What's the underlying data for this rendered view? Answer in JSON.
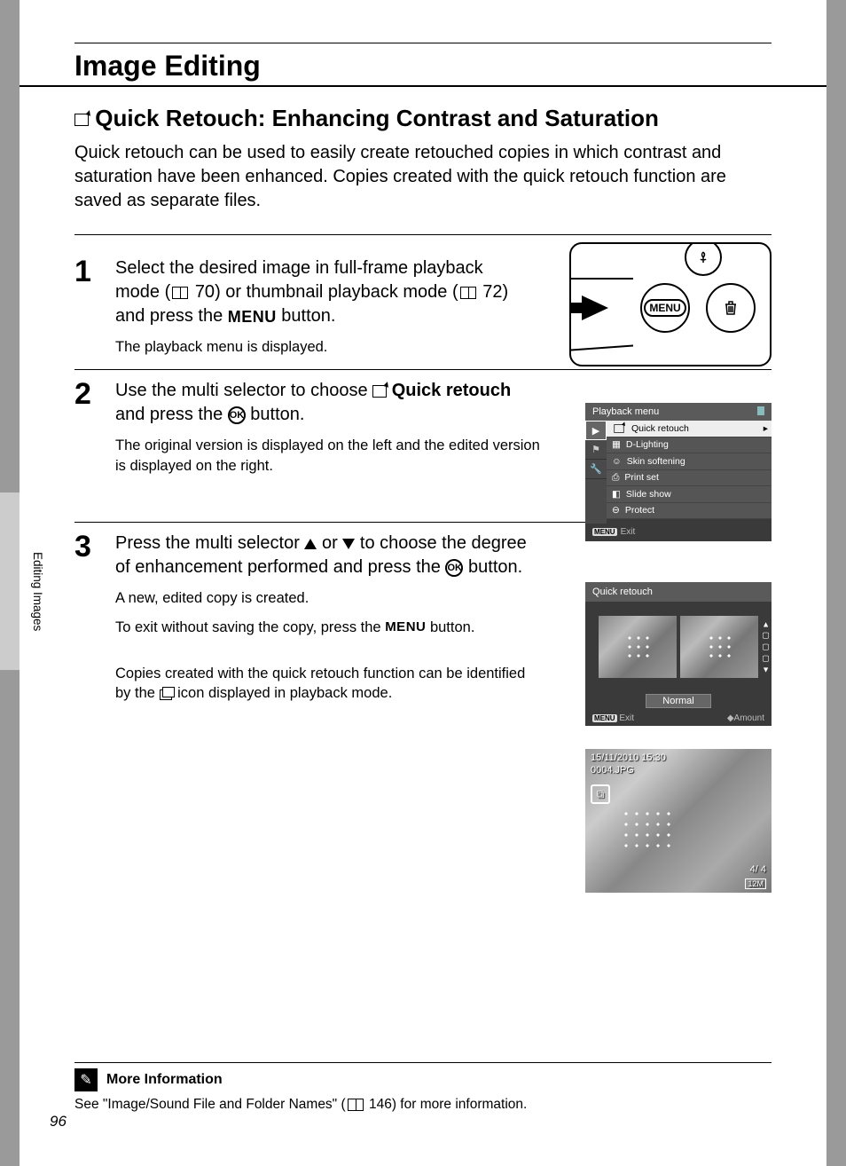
{
  "header": {
    "title": "Image Editing"
  },
  "section": {
    "title": "Quick Retouch: Enhancing Contrast and Saturation",
    "intro": "Quick retouch can be used to easily create retouched copies in which contrast and saturation have been enhanced. Copies created with the quick retouch function are saved as separate files."
  },
  "steps": {
    "s1": {
      "num": "1",
      "main_a": "Select the desired image in full-frame playback mode (",
      "ref1": "70",
      "main_b": ") or thumbnail playback mode (",
      "ref2": "72",
      "main_c": ") and press the ",
      "menu": "MENU",
      "main_d": " button.",
      "sub": "The playback menu is displayed."
    },
    "s2": {
      "num": "2",
      "main_a": "Use the multi selector to choose ",
      "bold1": "Quick retouch",
      "main_b": " and press the ",
      "ok": "OK",
      "main_c": " button.",
      "sub": "The original version is displayed on the left and the edited version is displayed on the right."
    },
    "s3": {
      "num": "3",
      "main_a": "Press the multi selector ",
      "main_b": " or ",
      "main_c": " to choose the degree of enhancement performed and press the ",
      "ok": "OK",
      "main_d": " button.",
      "sub1": "A new, edited copy is created.",
      "sub2_a": "To exit without saving the copy, press the ",
      "sub2_menu": "MENU",
      "sub2_b": " button.",
      "sub3_a": "Copies created with the quick retouch function can be identified by the ",
      "sub3_b": " icon displayed in playback mode."
    }
  },
  "camera": {
    "menu": "MENU"
  },
  "playback_menu": {
    "title": "Playback menu",
    "items": [
      "Quick retouch",
      "D-Lighting",
      "Skin softening",
      "Print set",
      "Slide show",
      "Protect"
    ],
    "exit_badge": "MENU",
    "exit": "Exit"
  },
  "quick_retouch_screen": {
    "title": "Quick retouch",
    "level": "Normal",
    "exit_badge": "MENU",
    "exit": "Exit",
    "amount": "Amount"
  },
  "playback_screen": {
    "date": "15/11/2010 15:30",
    "file": "0004.JPG",
    "size": "12M",
    "count": "4/     4"
  },
  "sidetab": "Editing Images",
  "more_info": {
    "title": "More Information",
    "body_a": "See \"Image/Sound File and Folder Names\" (",
    "ref": "146",
    "body_b": ") for more information."
  },
  "page_number": "96"
}
